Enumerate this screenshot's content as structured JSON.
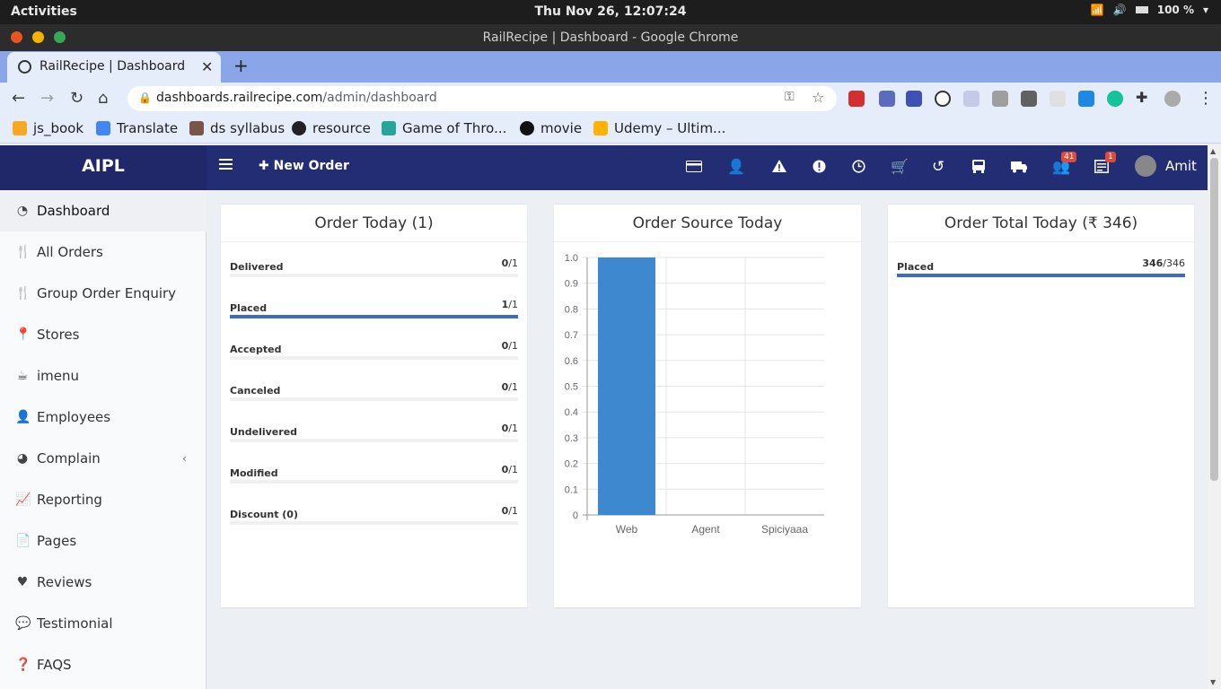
{
  "os": {
    "activities": "Activities",
    "clock": "Thu Nov 26, 12:07:24",
    "battery": "100 %"
  },
  "window": {
    "title": "RailRecipe | Dashboard - Google Chrome"
  },
  "browser": {
    "tab_title": "RailRecipe | Dashboard",
    "url_domain": "dashboards.railrecipe.com",
    "url_path": "/admin/dashboard",
    "bookmarks": [
      "js_book",
      "Translate",
      "ds syllabus",
      "resource",
      "Game of Thro...",
      "movie",
      "Udemy – Ultim..."
    ]
  },
  "header": {
    "brand": "AIPL",
    "new_order": "New Order",
    "icons": [
      "card-icon",
      "user-times-icon",
      "warning-icon",
      "exclamation-icon",
      "clock-icon",
      "cart-icon",
      "history-icon",
      "bus-icon",
      "truck-icon",
      "users-icon",
      "newspaper-icon"
    ],
    "users_badge": "41",
    "news_badge": "1",
    "user_name": "Amit"
  },
  "sidebar": {
    "items": [
      {
        "label": "Dashboard",
        "icon": "dashboard-icon"
      },
      {
        "label": "All Orders",
        "icon": "cutlery-icon"
      },
      {
        "label": "Group Order Enquiry",
        "icon": "cutlery-icon"
      },
      {
        "label": "Stores",
        "icon": "map-marker-icon"
      },
      {
        "label": "imenu",
        "icon": "coffee-icon"
      },
      {
        "label": "Employees",
        "icon": "user-plus-icon"
      },
      {
        "label": "Complain",
        "icon": "pie-chart-icon"
      },
      {
        "label": "Reporting",
        "icon": "line-chart-icon"
      },
      {
        "label": "Pages",
        "icon": "file-icon"
      },
      {
        "label": "Reviews",
        "icon": "heart-icon"
      },
      {
        "label": "Testimonial",
        "icon": "comment-icon"
      },
      {
        "label": "FAQS",
        "icon": "question-icon"
      }
    ]
  },
  "order_today": {
    "title": "Order Today (1)",
    "rows": [
      {
        "label": "Delivered",
        "value": "0",
        "total": "/1",
        "fraction": 0
      },
      {
        "label": "Placed",
        "value": "1",
        "total": "/1",
        "fraction": 1
      },
      {
        "label": "Accepted",
        "value": "0",
        "total": "/1",
        "fraction": 0
      },
      {
        "label": "Canceled",
        "value": "0",
        "total": "/1",
        "fraction": 0
      },
      {
        "label": "Undelivered",
        "value": "0",
        "total": "/1",
        "fraction": 0
      },
      {
        "label": "Modified",
        "value": "0",
        "total": "/1",
        "fraction": 0
      },
      {
        "label": "Discount (0)",
        "value": "0",
        "total": "/1",
        "fraction": 0
      }
    ]
  },
  "order_source": {
    "title": "Order Source Today"
  },
  "order_total": {
    "title": "Order Total Today (₹ 346)",
    "rows": [
      {
        "label": "Placed",
        "value": "346",
        "total": "/346",
        "fraction": 1
      }
    ]
  },
  "chart_data": {
    "type": "bar",
    "categories": [
      "Web",
      "Agent",
      "Spiciyaaa"
    ],
    "values": [
      1,
      0,
      0
    ],
    "ylim": [
      0,
      1
    ],
    "yticks": [
      "0",
      "0.1",
      "0.2",
      "0.3",
      "0.4",
      "0.5",
      "0.6",
      "0.7",
      "0.8",
      "0.9",
      "1.0"
    ],
    "bar_color": "#3d88cf",
    "grid": true
  },
  "colors": {
    "header": "#222d73",
    "brand": "#20286a",
    "accent": "#3c6dbd",
    "badge": "#dd4b39"
  }
}
